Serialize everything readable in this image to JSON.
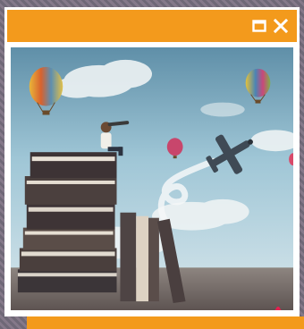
{
  "window": {
    "titlebar_color": "#f39a1c",
    "buttons": [
      {
        "name": "restore",
        "icon": "restore-window-icon"
      },
      {
        "name": "close",
        "icon": "close-icon"
      }
    ]
  },
  "image": {
    "subject": "child-on-stacked-books-with-telescope",
    "elements": [
      "hot-air-balloons",
      "airplane",
      "clouds",
      "stacked-books",
      "telescope"
    ]
  },
  "badge": {
    "icon": "copyright-icon",
    "symbol": "©",
    "color": "#e3204f"
  }
}
